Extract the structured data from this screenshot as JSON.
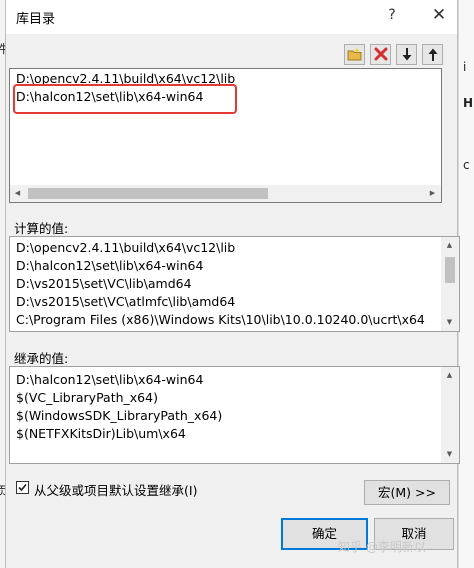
{
  "dialog": {
    "title": "库目录",
    "help_glyph": "?",
    "close_glyph": "✕"
  },
  "toolbar": {
    "new_line_icon": "new-folder-icon",
    "delete_icon": "delete-x-icon",
    "move_down_icon": "arrow-down-icon",
    "move_up_icon": "arrow-up-icon"
  },
  "editor": {
    "lines": [
      "D:\\opencv2.4.11\\build\\x64\\vc12\\lib",
      "D:\\halcon12\\set\\lib\\x64-win64"
    ]
  },
  "evaluated": {
    "label": "计算的值:",
    "lines": [
      "D:\\opencv2.4.11\\build\\x64\\vc12\\lib",
      "D:\\halcon12\\set\\lib\\x64-win64",
      "D:\\vs2015\\set\\VC\\lib\\amd64",
      "D:\\vs2015\\set\\VC\\atlmfc\\lib\\amd64",
      "C:\\Program Files (x86)\\Windows Kits\\10\\lib\\10.0.10240.0\\ucrt\\x64"
    ]
  },
  "inherited": {
    "label": "继承的值:",
    "lines": [
      "D:\\halcon12\\set\\lib\\x64-win64",
      "$(VC_LibraryPath_x64)",
      "$(WindowsSDK_LibraryPath_x64)",
      "$(NETFXKitsDir)Lib\\um\\x64"
    ]
  },
  "inherit_checkbox": {
    "label": "从父级或项目默认设置继承(I)",
    "checked": true
  },
  "buttons": {
    "macro": "宏(M) >>",
    "ok": "确定",
    "cancel": "取消"
  },
  "background": {
    "left_glyphs": [
      "件",
      "页"
    ],
    "right_glyphs": [
      "i",
      "H",
      "c"
    ]
  },
  "watermark": "知乎 @李明新以",
  "colors": {
    "highlight_box": "#e53935",
    "primary_border": "#0078d7",
    "delete_icon": "#d32f2f",
    "folder_icon": "#e8b84a"
  }
}
